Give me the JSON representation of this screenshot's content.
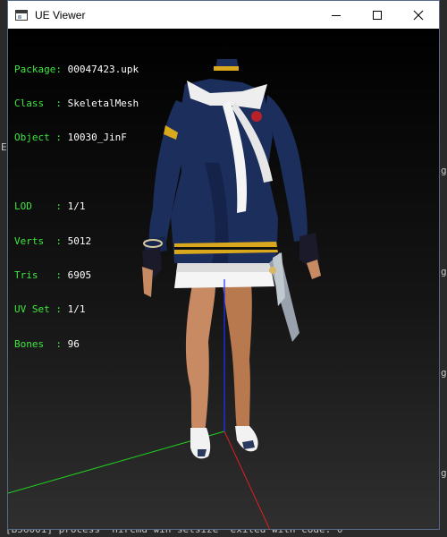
{
  "window": {
    "title": "UE Viewer",
    "controls": {
      "minimize": "minimize-icon",
      "maximize": "maximize-icon",
      "close": "close-icon"
    }
  },
  "background_console": {
    "line": "[B56001] process \"nircmd win setsize\" exited with code: 0",
    "edge_chars": [
      "E",
      "g",
      "g",
      "g",
      "g"
    ]
  },
  "info_panel": {
    "mesh": [
      {
        "label": "Package",
        "value": "00047423.upk"
      },
      {
        "label": "Class  ",
        "value": "SkeletalMesh"
      },
      {
        "label": "Object ",
        "value": "10030_JinF"
      }
    ],
    "stats": [
      {
        "label": "LOD    ",
        "value": "1/1"
      },
      {
        "label": "Verts  ",
        "value": "5012"
      },
      {
        "label": "Tris   ",
        "value": "6905"
      },
      {
        "label": "UV Set ",
        "value": "1/1"
      },
      {
        "label": "Bones  ",
        "value": "96"
      }
    ]
  },
  "colors": {
    "label_text": "#3ee83e",
    "value_text": "#ffffff",
    "axis_x": "#ff2020",
    "axis_y": "#20ff20",
    "axis_z": "#2040ff",
    "uniform_navy": "#1c2e5c",
    "skin": "#c78a63"
  }
}
